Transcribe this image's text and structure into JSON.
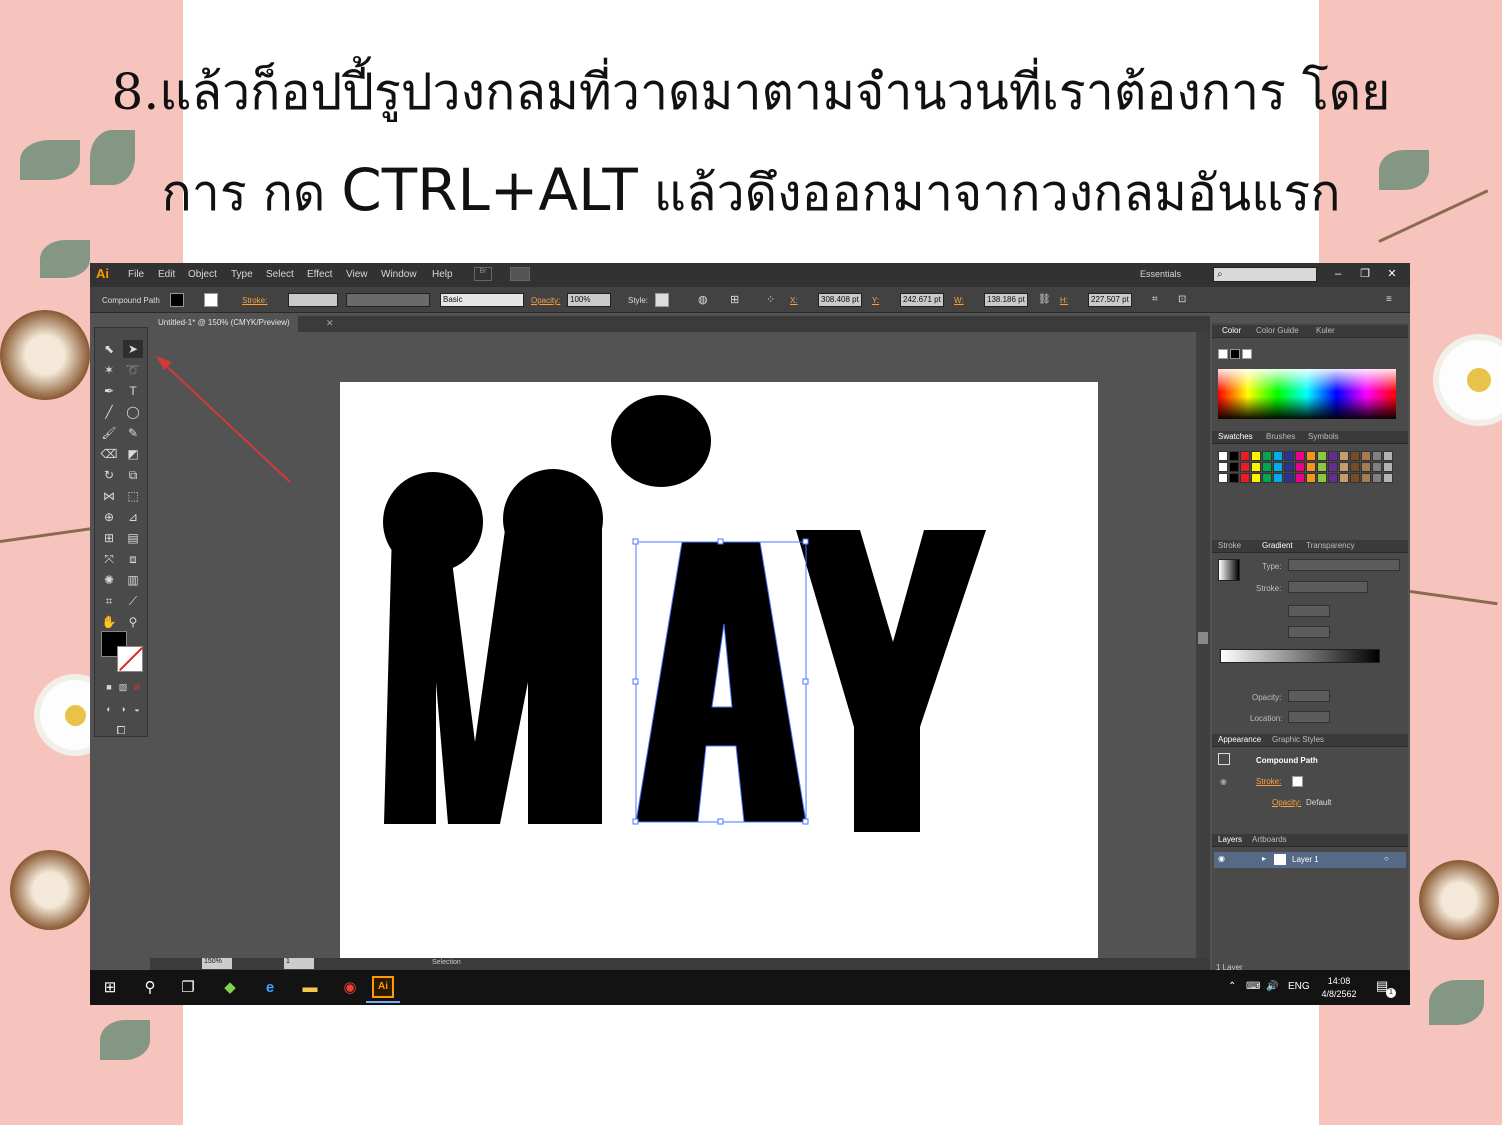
{
  "slide": {
    "title_line1": "8.แล้วก็อปปี้รูปวงกลมที่วาดมาตามจำนวนที่เราต้องการ โดย",
    "title_line2_a": "การ กด ",
    "title_line2_b": "CTRL+ALT",
    "title_line2_c": " แล้วดึงออกมาจากวงกลมอันแรก"
  },
  "app": {
    "logo": "Ai",
    "menu": [
      "File",
      "Edit",
      "Object",
      "Type",
      "Select",
      "Effect",
      "View",
      "Window",
      "Help"
    ],
    "bridge_label": "Br",
    "workspace": "Essentials",
    "window_controls": [
      "–",
      "❐",
      "✕"
    ]
  },
  "control_bar": {
    "selection_type": "Compound Path",
    "stroke_label": "Stroke:",
    "brush": "Basic",
    "opacity_label": "Opacity:",
    "opacity": "100%",
    "style_label": "Style:",
    "x_label": "X:",
    "x": "308.408 pt",
    "y_label": "Y:",
    "y": "242.671 pt",
    "w_label": "W:",
    "w": "138.186 pt",
    "h_label": "H:",
    "h": "227.507 pt"
  },
  "document": {
    "tab": "Untitled-1* @ 150% (CMYK/Preview)",
    "zoom": "150%",
    "artboard_number": "1",
    "status": "Selection"
  },
  "artwork": {
    "text": "MAY"
  },
  "panels": {
    "color_tabs": [
      "Color",
      "Color Guide",
      "Kuler"
    ],
    "swatch_tabs": [
      "Swatches",
      "Brushes",
      "Symbols"
    ],
    "gradient_tabs": [
      "Stroke",
      "Gradient",
      "Transparency"
    ],
    "gradient_type_label": "Type:",
    "gradient_stroke_label": "Stroke:",
    "opacity_label": "Opacity:",
    "location_label": "Location:",
    "appearance_tabs": [
      "Appearance",
      "Graphic Styles"
    ],
    "appearance_object": "Compound Path",
    "appearance_stroke": "Stroke:",
    "appearance_opacity": "Opacity:",
    "appearance_opacity_value": "Default",
    "layers_tabs": [
      "Layers",
      "Artboards"
    ],
    "layer_name": "Layer 1",
    "layers_count": "1 Layer",
    "swatch_colors": [
      "#ffffff",
      "#000000",
      "#ed1c24",
      "#fff200",
      "#00a651",
      "#00aeef",
      "#2e3192",
      "#ec008c",
      "#f7941d",
      "#8dc63f",
      "#662d91",
      "#c69c6d",
      "#754c24",
      "#a67c52",
      "#808080",
      "#b3b3b3"
    ]
  },
  "taskbar": {
    "lang": "ENG",
    "time": "14:08",
    "date": "4/8/2562",
    "notifications": "1"
  }
}
